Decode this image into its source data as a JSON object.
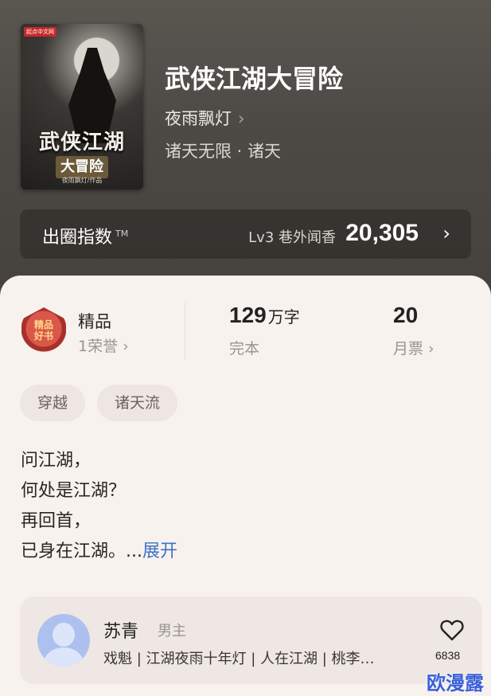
{
  "book": {
    "cover_badge": "起点中文网",
    "cover_title": "武侠江湖",
    "cover_subtitle": "大冒险",
    "cover_author": "夜雨飘灯/作品",
    "title": "武侠江湖大冒险",
    "author": "夜雨飘灯",
    "genre": "诸天无限 · 诸天"
  },
  "score": {
    "label": "出圈指数",
    "tm": "TM",
    "level": "Lv3 巷外闻香",
    "value": "20,305",
    "chevron": "›"
  },
  "stats": {
    "badge_text": "精品\n好书",
    "quality_label": "精品",
    "honor_label": "1荣誉 ›",
    "word_count": "129",
    "word_unit": "万字",
    "status": "完本",
    "monthly_tickets": "20",
    "monthly_label": "月票 ›"
  },
  "tags": [
    "穿越",
    "诸天流"
  ],
  "synopsis": {
    "lines": [
      "问江湖，",
      "何处是江湖？",
      "再回首，",
      "已身在江湖。..."
    ],
    "expand": "展开"
  },
  "character": {
    "name": "苏青",
    "role": "男主",
    "description": "戏魁 | 江湖夜雨十年灯 | 人在江湖 | 桃李…",
    "likes": "6838"
  },
  "watermark": "欧漫露"
}
